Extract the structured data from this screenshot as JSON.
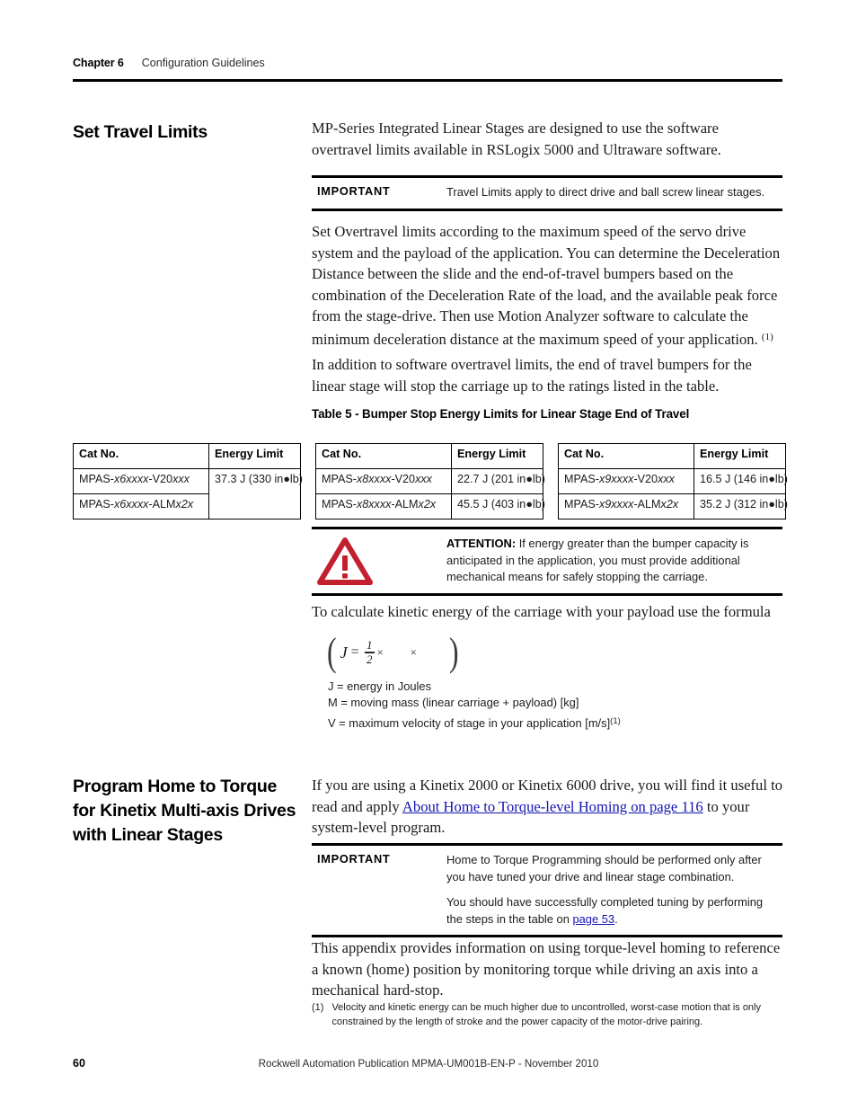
{
  "header": {
    "chapter": "Chapter 6",
    "section": "Configuration Guidelines"
  },
  "sections": [
    {
      "heading": "Set Travel Limits",
      "intro": "MP-Series Integrated Linear Stages are designed to use the software overtravel limits available in RSLogix 5000 and Ultraware software."
    },
    {
      "heading": "Program Home to Torque for Kinetix Multi-axis Drives with Linear Stages"
    }
  ],
  "notices": {
    "important_travel": {
      "label": "IMPORTANT",
      "text": "Travel Limits apply to direct drive and ball screw linear stages."
    },
    "attention_bumper": {
      "label_bold": "ATTENTION:",
      "icon": "warning-triangle-icon",
      "color": "#C3202F",
      "text": "If energy greater than the bumper capacity is anticipated in the application, you must provide additional mechanical means for safely stopping the carriage."
    },
    "important_home_torque": {
      "label": "IMPORTANT",
      "paragraph1": "Home to Torque Programming should be performed only after you have tuned your drive and linear stage combination.",
      "paragraph2_pre": "You should have successfully completed tuning by performing the steps in the table on ",
      "paragraph2_link": "page 53",
      "paragraph2_post": "."
    }
  },
  "paragraphs": {
    "overtravel": "Set Overtravel limits according to the maximum speed of the servo drive system and the payload of the application. You can determine the Deceleration Distance between the slide and the end-of-travel bumpers based on the combination of the Deceleration Rate of the load, and the available peak force from the stage-drive. Then use Motion Analyzer software to calculate the minimum deceleration distance at the maximum speed of your application.",
    "overtravel_footnote_mark": "(1)",
    "bumpers": "In addition to software overtravel limits, the end of travel bumpers for the linear stage will stop the carriage up to the ratings listed in the table.",
    "formula_lead": "To calculate kinetic energy of the carriage with your payload use the formula",
    "home_torque_pre": "If you are using a Kinetix 2000 or Kinetix 6000 drive, you will find it useful to read and apply ",
    "home_torque_link": "About Home to Torque-level Homing on page 116",
    "home_torque_post": " to your system-level program.",
    "appendix": "This appendix provides information on using torque-level homing to reference a known (home) position by monitoring torque while driving an axis into a mechanical hard-stop."
  },
  "table": {
    "caption": "Table 5 - Bumper Stop Energy Limits for Linear Stage End of Travel",
    "headers": [
      "Cat No.",
      "Energy Limit"
    ],
    "blocks": [
      {
        "rows": [
          {
            "cat_plain1": "MPAS-",
            "cat_italic1": "x6xxxx",
            "cat_plain2": "-V20",
            "cat_italic2": "xxx",
            "energy": "37.3 J (330 in●lb)",
            "energy_rowspan": 2
          },
          {
            "cat_plain1": "MPAS-",
            "cat_italic1": "x6xxxx",
            "cat_plain2": "-ALM",
            "cat_italic2": "x2x",
            "energy": "",
            "energy_rowspan": 0
          }
        ]
      },
      {
        "rows": [
          {
            "cat_plain1": "MPAS-",
            "cat_italic1": "x8xxxx",
            "cat_plain2": "-V20",
            "cat_italic2": "xxx",
            "energy": "22.7 J (201 in●lb)",
            "energy_rowspan": 1
          },
          {
            "cat_plain1": "MPAS-",
            "cat_italic1": "x8xxxx",
            "cat_plain2": "-ALM",
            "cat_italic2": "x2x",
            "energy": "45.5 J (403 in●lb)",
            "energy_rowspan": 1
          }
        ]
      },
      {
        "rows": [
          {
            "cat_plain1": "MPAS-",
            "cat_italic1": "x9xxxx",
            "cat_plain2": "-V20",
            "cat_italic2": "xxx",
            "energy": "16.5 J (146 in●lb)",
            "energy_rowspan": 1
          },
          {
            "cat_plain1": "MPAS-",
            "cat_italic1": "x9xxxx",
            "cat_plain2": "-ALM",
            "cat_italic2": "x2x",
            "energy": "35.2 J (312 in●lb)",
            "energy_rowspan": 1
          }
        ]
      }
    ]
  },
  "formula": {
    "open_paren": "(",
    "variable": "J",
    "equals": "=",
    "numerator": "1",
    "denominator": "2",
    "times1": "×",
    "times2": "×",
    "close_paren": ")",
    "legend": [
      "J = energy in Joules",
      "M = moving mass (linear carriage + payload) [kg]",
      "V = maximum velocity of stage in your application [m/s]"
    ],
    "legend_footnote_mark": "(1)"
  },
  "footnote": {
    "mark": "(1)",
    "text": "Velocity and kinetic energy can be much higher due to uncontrolled, worst-case motion that is only constrained by the length of stroke and the power capacity of the motor-drive pairing."
  },
  "footer": {
    "page_number": "60",
    "publication": "Rockwell Automation Publication MPMA-UM001B-EN-P - November 2010"
  }
}
